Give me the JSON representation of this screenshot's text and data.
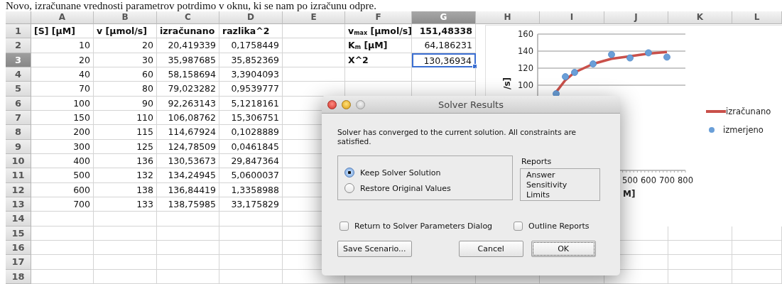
{
  "caption": "Novo, izračunane vrednosti parametrov potrdimo v oknu, ki se nam po izračunu odpre.",
  "spreadsheet": {
    "columns": [
      {
        "label": "A",
        "selected": false
      },
      {
        "label": "B",
        "selected": false
      },
      {
        "label": "C",
        "selected": false
      },
      {
        "label": "D",
        "selected": false
      },
      {
        "label": "E",
        "selected": false
      },
      {
        "label": "F",
        "selected": false
      },
      {
        "label": "G",
        "selected": true
      },
      {
        "label": "H",
        "selected": false
      },
      {
        "label": "I",
        "selected": false
      },
      {
        "label": "J",
        "selected": false
      },
      {
        "label": "K",
        "selected": false
      },
      {
        "label": "L",
        "selected": false
      }
    ],
    "rows": [
      {
        "header": "1",
        "selected": false,
        "cells": [
          "[S] [µM]",
          "v [µmol/s]",
          "izračunano",
          "razlika^2",
          null,
          "v$_{max}$ [µmol/s]",
          "151,48338"
        ]
      },
      {
        "header": "2",
        "selected": false,
        "cells": [
          "10",
          "20",
          "20,419339",
          "0,1758449",
          null,
          "K$_{m}$ [µM]",
          "64,186231"
        ]
      },
      {
        "header": "3",
        "selected": true,
        "cells": [
          "20",
          "30",
          "35,987685",
          "35,852369",
          null,
          "X^2",
          "130,36934"
        ]
      },
      {
        "header": "4",
        "selected": false,
        "cells": [
          "40",
          "60",
          "58,158694",
          "3,3904093"
        ]
      },
      {
        "header": "5",
        "selected": false,
        "cells": [
          "70",
          "80",
          "79,023282",
          "0,9539777"
        ]
      },
      {
        "header": "6",
        "selected": false,
        "cells": [
          "100",
          "90",
          "92,263143",
          "5,1218161"
        ]
      },
      {
        "header": "7",
        "selected": false,
        "cells": [
          "150",
          "110",
          "106,08762",
          "15,306751"
        ]
      },
      {
        "header": "8",
        "selected": false,
        "cells": [
          "200",
          "115",
          "114,67924",
          "0,1028889"
        ]
      },
      {
        "header": "9",
        "selected": false,
        "cells": [
          "300",
          "125",
          "124,78509",
          "0,0461845"
        ]
      },
      {
        "header": "10",
        "selected": false,
        "cells": [
          "400",
          "136",
          "130,53673",
          "29,847364"
        ]
      },
      {
        "header": "11",
        "selected": false,
        "cells": [
          "500",
          "132",
          "134,24945",
          "5,0600037"
        ]
      },
      {
        "header": "12",
        "selected": false,
        "cells": [
          "600",
          "138",
          "136,84419",
          "1,3358988"
        ]
      },
      {
        "header": "13",
        "selected": false,
        "cells": [
          "700",
          "133",
          "138,75985",
          "33,175829"
        ]
      },
      {
        "header": "14",
        "selected": false
      },
      {
        "header": "15",
        "selected": false
      },
      {
        "header": "16",
        "selected": false
      },
      {
        "header": "17",
        "selected": false
      },
      {
        "header": "18",
        "selected": false
      }
    ]
  },
  "chart": {
    "chart_data": {
      "type": "scatter",
      "xlabel": "M]",
      "ylabel": "/s]",
      "grid": true,
      "legend": "right",
      "x": [
        100,
        150,
        200,
        300,
        400,
        500,
        600,
        700
      ],
      "series": [
        {
          "name": "izračunano",
          "type": "line",
          "color": "#c9504a",
          "values": [
            92,
            106,
            115,
            125,
            131,
            134,
            137,
            139
          ]
        },
        {
          "name": "izmerjeno",
          "color": "#6a9fd8",
          "values": [
            90,
            110,
            115,
            125,
            136,
            132,
            138,
            133
          ]
        }
      ],
      "xlim": [
        0,
        800
      ],
      "ylim": [
        0,
        160
      ],
      "xticks": [
        500,
        600,
        700,
        800
      ],
      "yticks": [
        100,
        120,
        140,
        160
      ]
    }
  },
  "dialog": {
    "title": "Solver Results",
    "message": "Solver has converged to the current solution.  All constraints are satisfied.",
    "options": [
      {
        "label": "Keep Solver Solution",
        "selected": true
      },
      {
        "label": "Restore Original Values",
        "selected": false
      }
    ],
    "reports": {
      "label": "Reports",
      "items": [
        "Answer",
        "Sensitivity",
        "Limits"
      ]
    },
    "checkboxes": [
      {
        "label": "Return to Solver Parameters Dialog",
        "checked": false
      },
      {
        "label": "Outline Reports",
        "checked": false
      }
    ],
    "buttons": [
      {
        "label": "Save Scenario...",
        "kind": "normal"
      },
      {
        "label": "Cancel",
        "kind": "normal"
      },
      {
        "label": "OK",
        "kind": "default"
      }
    ]
  }
}
